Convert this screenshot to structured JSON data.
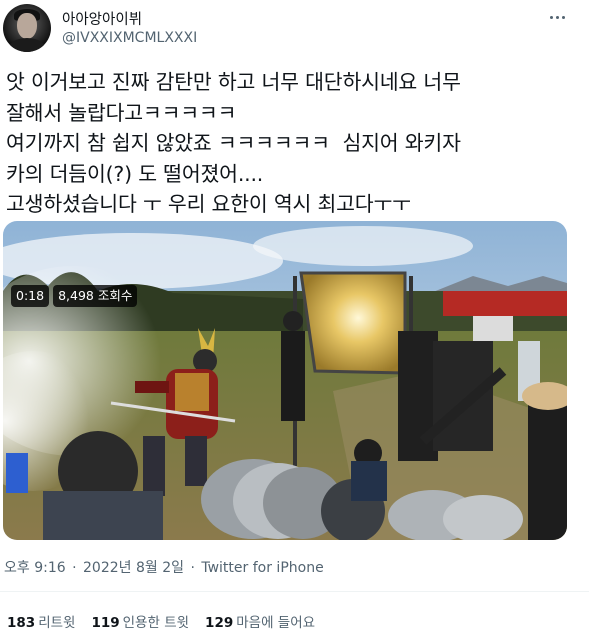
{
  "tweet": {
    "display_name": "아아앙아이뷔",
    "username": "@IVXXIXMCMLXXXI",
    "text": "앗 이거보고 진짜 감탄만 하고 너무 대단하시네요 너무\n잘해서 놀랍다고ㅋㅋㅋㅋㅋ\n여기까지 참 쉽지 않았죠 ㅋㅋㅋㅋㅋㅋ  심지어 와키자\n카의 더듬이(?) 도 떨어졌어....\n고생하셨습니다 ㅜ 우리 요한이 역시 최고다ㅜㅜ",
    "media": {
      "duration": "0:18",
      "view_count": "8,498",
      "view_label": "조회수"
    },
    "meta": {
      "time": "오후 9:16",
      "separator": "·",
      "date": "2022년 8월 2일",
      "source": "Twitter for iPhone"
    },
    "stats": {
      "retweets_count": "183",
      "retweets_label": "리트윗",
      "quotes_count": "119",
      "quotes_label": "인용한 트윗",
      "likes_count": "129",
      "likes_label": "마음에 들어요"
    }
  },
  "icons": {
    "more": "more-horizontal-icon",
    "avatar": "profile-avatar"
  }
}
